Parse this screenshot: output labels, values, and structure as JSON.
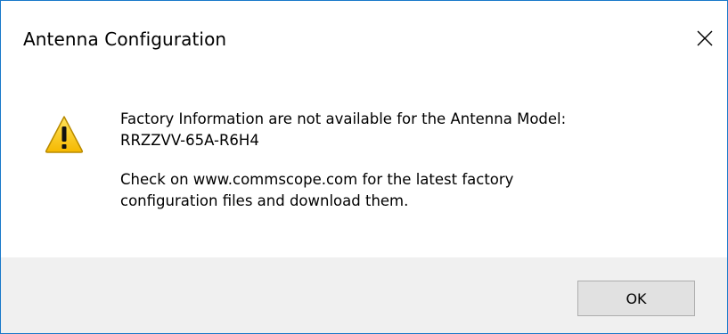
{
  "window": {
    "title": "Antenna Configuration",
    "close_icon": "close-icon"
  },
  "message": {
    "icon": "warning-icon",
    "line1": "Factory Information are not available for the Antenna Model:",
    "line2": "RRZZVV-65A-R6H4",
    "line3": "Check on www.commscope.com for the latest factory",
    "line4": "configuration files and download them."
  },
  "buttons": {
    "ok_label": "OK"
  },
  "colors": {
    "border": "#1979ca",
    "footer_bg": "#f0f0f0",
    "button_bg": "#e1e1e1",
    "warning_fill": "#fcd116",
    "warning_stroke": "#b88a00"
  }
}
